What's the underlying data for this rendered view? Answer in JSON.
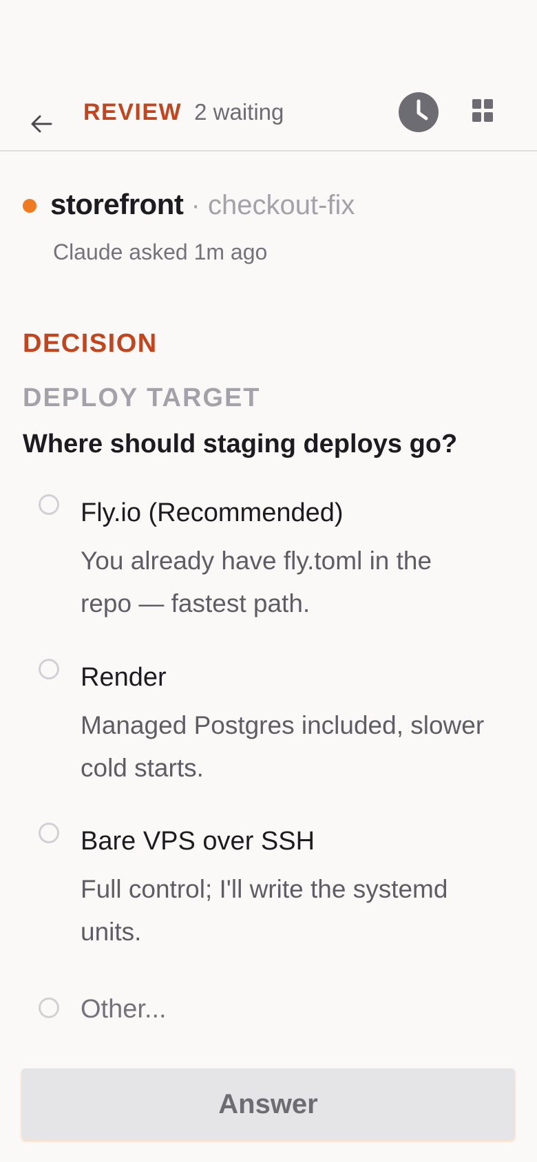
{
  "header": {
    "title": "REVIEW",
    "waiting": "2 waiting",
    "back_icon": "arrow-left-icon",
    "history_icon": "clock-icon",
    "grid_icon": "grid-icon"
  },
  "session": {
    "name": "storefront",
    "branch": "· checkout-fix",
    "asked": "Claude asked 1m ago",
    "status_color": "#f07a1f"
  },
  "prompt": {
    "section": "DECISION",
    "header": "DEPLOY TARGET",
    "question": "Where should staging deploys go?",
    "options": [
      {
        "label": "Fly.io (Recommended)",
        "description": "You already have fly.toml in the repo — fastest path."
      },
      {
        "label": "Render",
        "description": "Managed Postgres included, slower cold starts."
      },
      {
        "label": "Bare VPS over SSH",
        "description": "Full control; I'll write the systemd units."
      },
      {
        "label": "Other..."
      }
    ]
  },
  "answer_button": "Answer",
  "colors": {
    "accent": "#c2451e",
    "background": "#faf9f7",
    "muted": "#a3a2a8"
  }
}
